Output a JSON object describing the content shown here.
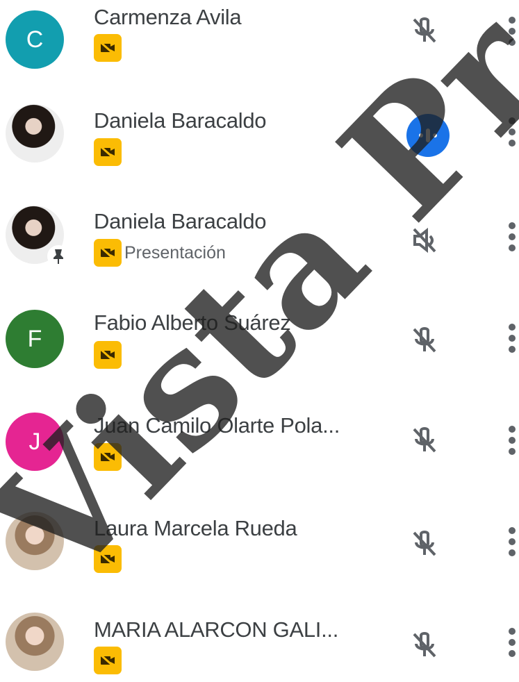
{
  "participants": [
    {
      "name": "Carmenza Avila",
      "avatar_type": "initial",
      "initial": "C",
      "avatar_color": "#129eaf",
      "camera_label": "",
      "mic_state": "muted"
    },
    {
      "name": "Daniela Baracaldo",
      "avatar_type": "photo",
      "camera_label": "",
      "mic_state": "speaking"
    },
    {
      "name": "Daniela Baracaldo",
      "avatar_type": "photo-pinned",
      "camera_label": "Presentación",
      "mic_state": "muted-presentation"
    },
    {
      "name": "Fabio Alberto Suárez",
      "avatar_type": "initial",
      "initial": "F",
      "avatar_color": "#2e7d32",
      "camera_label": "",
      "mic_state": "muted"
    },
    {
      "name": "Juan Camilo Olarte Pola...",
      "avatar_type": "initial",
      "initial": "J",
      "avatar_color": "#e52592",
      "camera_label": "",
      "mic_state": "muted"
    },
    {
      "name": "Laura Marcela Rueda",
      "avatar_type": "photo",
      "camera_label": "",
      "mic_state": "muted"
    },
    {
      "name": "MARIA ALARCON GALI...",
      "avatar_type": "photo",
      "camera_label": "",
      "mic_state": "muted"
    }
  ],
  "watermark": "Vista Pr",
  "colors": {
    "camera_badge": "#fbbc04",
    "speaking": "#1a73e8",
    "text": "#3c4043"
  }
}
